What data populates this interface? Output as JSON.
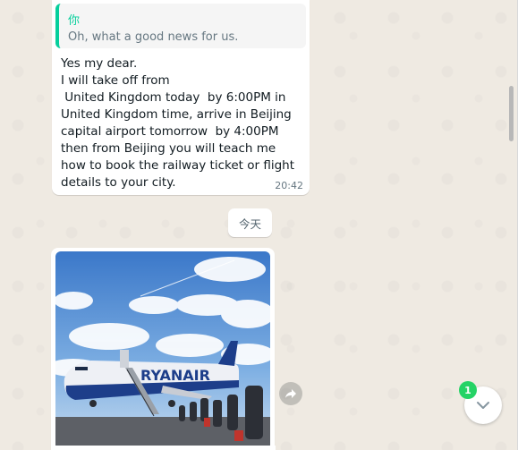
{
  "messages": [
    {
      "quote": {
        "author": "你",
        "text": "Oh, what a good news for us."
      },
      "text": "Yes my dear.\nI will take off from\n United Kingdom today  by 6:00PM in United Kingdom time, arrive in Beijing capital airport tomorrow  by 4:00PM then from Beijing you will teach me how to book the railway ticket or flight details to your city.",
      "time": "20:42"
    }
  ],
  "date_separator": "今天",
  "photo_message": {
    "image_subject": "airplane-photo",
    "airline_text": "RYANAIR"
  },
  "scroll_down": {
    "unread_count": "1"
  },
  "colors": {
    "chat_background": "#efeae2",
    "incoming_bubble": "#ffffff",
    "quote_accent": "#06cf9c",
    "badge": "#25d366",
    "meta_text": "#667781"
  },
  "icons": {
    "forward": "forward-icon",
    "scroll_down": "chevron-down-icon"
  }
}
